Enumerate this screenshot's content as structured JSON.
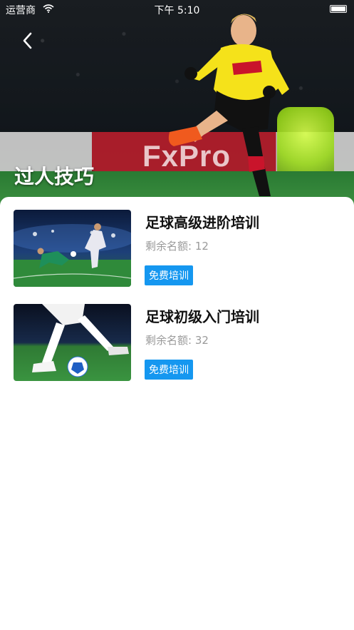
{
  "status_bar": {
    "carrier": "运营商",
    "time": "下午 5:10"
  },
  "header": {
    "title": "过人技巧",
    "ad_text": "FxPro"
  },
  "courses": [
    {
      "title": "足球高级进阶培训",
      "quota": "剩余名额: 12",
      "badge": "免费培训"
    },
    {
      "title": "足球初级入门培训",
      "quota": "剩余名额: 32",
      "badge": "免费培训"
    }
  ],
  "icons": {
    "back": "chevron-left-icon",
    "wifi": "wifi-icon",
    "battery": "battery-icon"
  },
  "colors": {
    "accent": "#1597f0",
    "title": "#111111",
    "muted": "#9a9a9a",
    "jersey": "#f5e21a"
  }
}
